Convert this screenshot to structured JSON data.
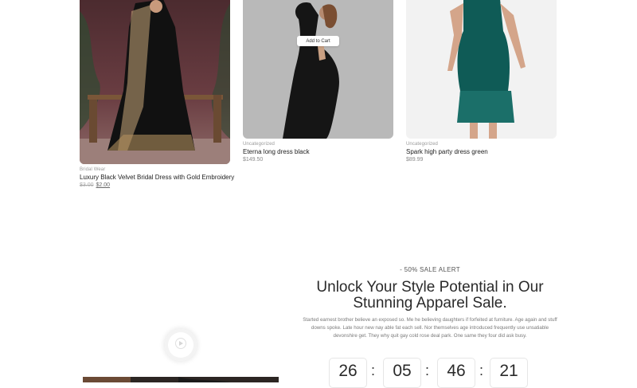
{
  "products": [
    {
      "category": "Bridal Wear",
      "name": "Luxury Black Velvet Bridal Dress with Gold Embroidery",
      "old_price": "$3.00",
      "price": "$2.00"
    },
    {
      "category": "Uncategorized",
      "name": "Eterna long dress black",
      "price": "$149.50",
      "add_to_cart": "Add to Cart"
    },
    {
      "category": "Uncategorized",
      "name": "Spark high party dress green",
      "price": "$89.99"
    }
  ],
  "sale": {
    "eyebrow": "- 50% SALE ALERT",
    "headline_line1": "Unlock Your Style Potential in Our",
    "headline_line2": "Stunning Apparel Sale.",
    "description": "Started earnest brother believe an exposed so. Me he believing daughters if forfeited at furniture. Age again and stuff downs spoke. Late hour new nay able fat each sell. Nor themselves age introduced frequently use unsatiable devonshire get. They why quit gay cold rose deal park. One same they four did ask busy.",
    "countdown": [
      "26",
      "05",
      "46",
      "21"
    ],
    "separator": ":"
  },
  "icons": {
    "play": "play-icon"
  }
}
